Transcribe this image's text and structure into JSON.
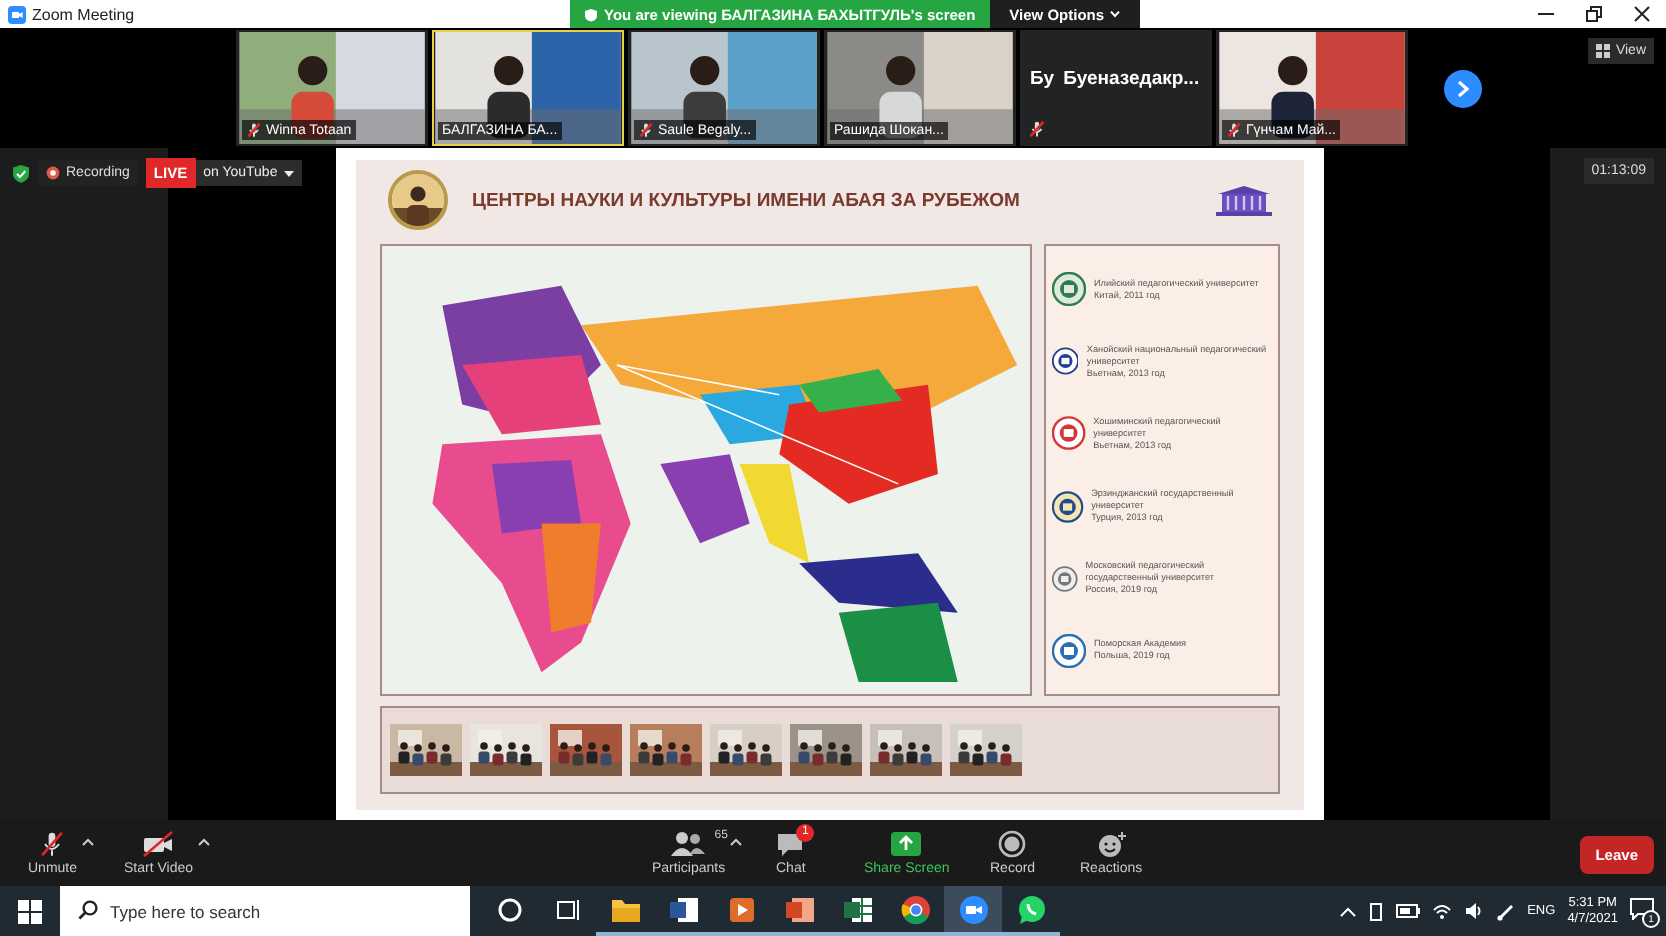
{
  "window": {
    "title": "Zoom Meeting"
  },
  "share_banner": {
    "text": "You are viewing БАЛГАЗИНА БАХЫТГУЛЬ's screen",
    "view_options": "View Options"
  },
  "participants": [
    {
      "name": "Winna Totaan",
      "muted": true,
      "video": true,
      "active": false
    },
    {
      "name": "БАЛГАЗИНА БА...",
      "muted": false,
      "video": true,
      "active": true
    },
    {
      "name": "Saule Begaly...",
      "muted": true,
      "video": true,
      "active": false
    },
    {
      "name": "Рашида Шокан...",
      "muted": false,
      "video": true,
      "active": false
    },
    {
      "name": "Бу  Буеназедакр...",
      "muted": true,
      "video": false,
      "active": false
    },
    {
      "name": "Гүнчам Май...",
      "muted": true,
      "video": true,
      "active": false
    }
  ],
  "view_button": "View",
  "recording": {
    "label": "Recording",
    "live": "LIVE",
    "stream": "on YouTube"
  },
  "timer": "01:13:09",
  "slide": {
    "title": "ЦЕНТРЫ НАУКИ И КУЛЬТУРЫ ИМЕНИ АБАЯ ЗА РУБЕЖОМ",
    "centers": [
      {
        "name": "Илийский педагогический университет",
        "place": "Китай, 2011 год"
      },
      {
        "name": "Ханойский национальный педагогический университет",
        "place": "Вьетнам, 2013 год"
      },
      {
        "name": "Хошиминский педагогический университет",
        "place": "Вьетнам, 2013 год"
      },
      {
        "name": "Эрзинджанский государственный университет",
        "place": "Турция, 2013 год"
      },
      {
        "name": "Московский педагогический государственный университет",
        "place": "Россия, 2019 год"
      },
      {
        "name": "Поморская Академия",
        "place": "Польша, 2019 год"
      }
    ]
  },
  "toolbar": [
    {
      "kind": "mic",
      "label": "Unmute",
      "caret": true
    },
    {
      "kind": "video",
      "label": "Start Video",
      "caret": true
    },
    {
      "kind": "participants",
      "label": "Participants",
      "count": "65",
      "caret": true
    },
    {
      "kind": "chat",
      "label": "Chat",
      "badge": "1"
    },
    {
      "kind": "share",
      "label": "Share Screen"
    },
    {
      "kind": "record",
      "label": "Record"
    },
    {
      "kind": "reactions",
      "label": "Reactions"
    }
  ],
  "leave": "Leave",
  "taskbar": {
    "search_placeholder": "Type here to search",
    "apps": [
      {
        "kind": "cortana",
        "running": false,
        "selected": false
      },
      {
        "kind": "taskview",
        "running": false,
        "selected": false
      },
      {
        "kind": "explorer",
        "running": true,
        "selected": false
      },
      {
        "kind": "word",
        "running": true,
        "selected": false
      },
      {
        "kind": "media",
        "running": true,
        "selected": false
      },
      {
        "kind": "powerpoint",
        "running": true,
        "selected": false
      },
      {
        "kind": "excel",
        "running": true,
        "selected": false
      },
      {
        "kind": "chrome",
        "running": true,
        "selected": false
      },
      {
        "kind": "zoom",
        "running": true,
        "selected": true
      },
      {
        "kind": "whatsapp",
        "running": true,
        "selected": false
      }
    ],
    "language": "ENG",
    "time": "5:31 PM",
    "date": "4/7/2021",
    "notifications": "1"
  }
}
